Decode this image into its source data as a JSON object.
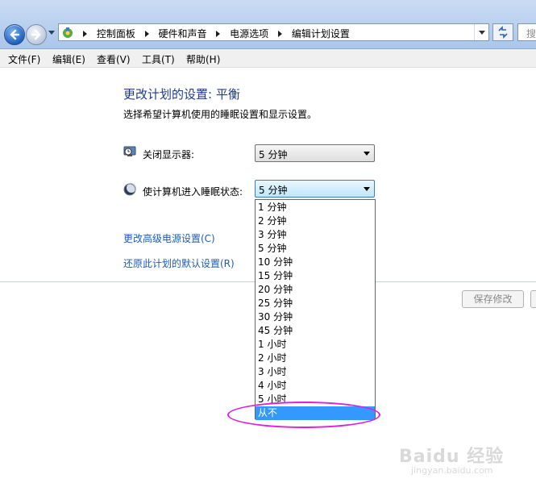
{
  "address_bar": {
    "crumbs": [
      "控制面板",
      "硬件和声音",
      "电源选项",
      "编辑计划设置"
    ],
    "search_placeholder": "搜"
  },
  "menu": [
    "文件(F)",
    "编辑(E)",
    "查看(V)",
    "工具(T)",
    "帮助(H)"
  ],
  "page": {
    "title": "更改计划的设置: 平衡",
    "subtitle": "选择希望计算机使用的睡眠设置和显示设置。",
    "display_off_label": "关闭显示器:",
    "display_off_value": "5 分钟",
    "sleep_label": "使计算机进入睡眠状态:",
    "sleep_value": "5 分钟",
    "advanced_link": "更改高级电源设置(C)",
    "restore_link": "还原此计划的默认设置(R)",
    "save_button": "保存修改"
  },
  "dropdown_options": [
    "1 分钟",
    "2 分钟",
    "3 分钟",
    "5 分钟",
    "10 分钟",
    "15 分钟",
    "20 分钟",
    "25 分钟",
    "30 分钟",
    "45 分钟",
    "1 小时",
    "2 小时",
    "3 小时",
    "4 小时",
    "5 小时",
    "从不"
  ],
  "dropdown_selected": "从不",
  "watermark": {
    "main": "Baidu 经验",
    "sub": "jingyan.baidu.com"
  },
  "colors": {
    "title": "#1e3a8c",
    "link": "#1e5cb3",
    "selection": "#3399ff",
    "highlight_ellipse": "#e01ee0"
  }
}
